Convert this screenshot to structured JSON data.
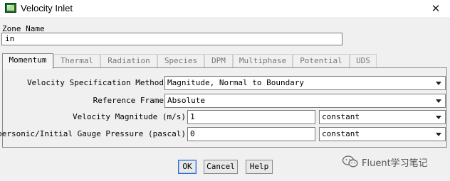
{
  "window": {
    "title": "Velocity Inlet",
    "close_glyph": "✕"
  },
  "zone": {
    "label": "Zone Name",
    "value": "in"
  },
  "tabs": [
    {
      "label": "Momentum",
      "active": true
    },
    {
      "label": "Thermal",
      "active": false
    },
    {
      "label": "Radiation",
      "active": false
    },
    {
      "label": "Species",
      "active": false
    },
    {
      "label": "DPM",
      "active": false
    },
    {
      "label": "Multiphase",
      "active": false
    },
    {
      "label": "Potential",
      "active": false
    },
    {
      "label": "UDS",
      "active": false
    }
  ],
  "momentum": {
    "velocity_spec_label": "Velocity Specification Method",
    "velocity_spec_value": "Magnitude, Normal to Boundary",
    "reference_frame_label": "Reference Frame",
    "reference_frame_value": "Absolute",
    "velocity_magnitude_label": "Velocity Magnitude (m/s)",
    "velocity_magnitude_value": "1",
    "velocity_magnitude_method": "constant",
    "gauge_pressure_label": "Supersonic/Initial Gauge Pressure (pascal)",
    "gauge_pressure_value": "0",
    "gauge_pressure_method": "constant"
  },
  "buttons": {
    "ok": "OK",
    "cancel": "Cancel",
    "help": "Help"
  },
  "watermark": {
    "text": "Fluent学习笔记",
    "icon": "wechat-icon"
  }
}
